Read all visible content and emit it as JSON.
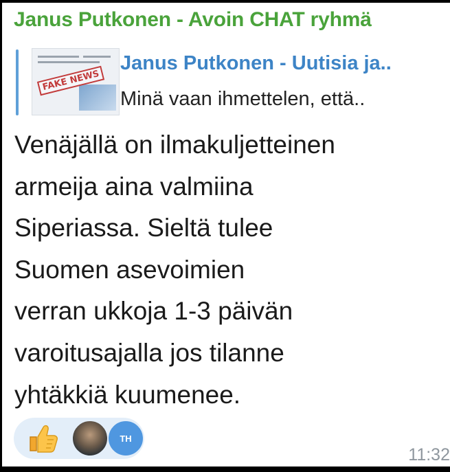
{
  "message": {
    "sender": "Janus Putkonen - Avoin CHAT ryhmä",
    "reply": {
      "title": "Janus Putkonen - Uutisia ja..",
      "text": "Minä vaan ihmettelen, että..",
      "thumbnail_stamp": "FAKE NEWS"
    },
    "body_lines": [
      "Venäjällä on ilmakuljetteinen",
      "armeija aina valmiina",
      "Siperiassa. Sieltä tulee",
      "Suomen asevoimien",
      "verran ukkoja 1-3 päivän",
      "varoitusajalla jos tilanne",
      "yhtäkkiä kuumenee."
    ],
    "reactions": {
      "emoji_icon": "thumbs-up-icon",
      "avatars": [
        {
          "icon": "user-photo-avatar"
        },
        {
          "initials": "TH"
        }
      ]
    },
    "time": "11:32"
  },
  "colors": {
    "sender": "#4aa33b",
    "reply_title": "#3d84c6",
    "reply_bar": "#5fa0d8",
    "reaction_bg": "#e3eef9",
    "time": "#8f979e"
  }
}
